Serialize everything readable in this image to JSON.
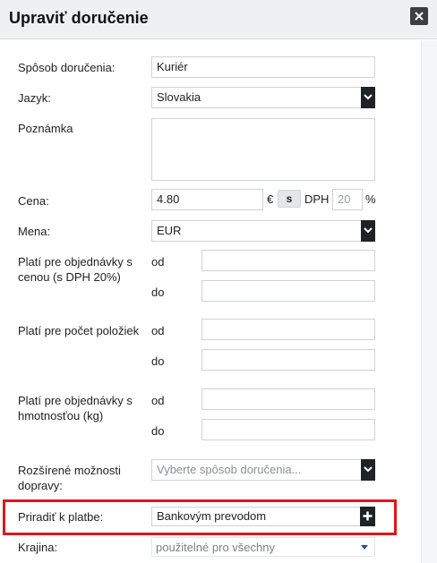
{
  "dialog": {
    "title": "Upraviť doručenie",
    "close_icon": "close-icon"
  },
  "form": {
    "sposob": {
      "label": "Spôsob doručenia:",
      "value": "Kuriér"
    },
    "jazyk": {
      "label": "Jazyk:",
      "value": "Slovakia"
    },
    "poznamka": {
      "label": "Poznámka",
      "value": ""
    },
    "cena": {
      "label": "Cena:",
      "value": "4.80",
      "currency_symbol": "€",
      "s_button": "s",
      "dph_label": "DPH",
      "dph_value": "20",
      "percent": "%"
    },
    "mena": {
      "label": "Mena:",
      "value": "EUR"
    },
    "cenou": {
      "label_line1": "Platí pre objednávky s",
      "label_line2": "cenou (s DPH 20%)",
      "od": "od",
      "do": "do",
      "od_value": "",
      "do_value": ""
    },
    "pocet": {
      "label": "Platí pre počet položiek",
      "od": "od",
      "do": "do",
      "od_value": "",
      "do_value": ""
    },
    "hmotnost": {
      "label_line1": "Platí pre objednávky s",
      "label_line2": "hmotnosťou (kg)",
      "od": "od",
      "do": "do",
      "od_value": "",
      "do_value": ""
    },
    "rozsirene": {
      "label_line1": "Rozšírené možnosti",
      "label_line2": "dopravy:",
      "placeholder": "Vyberte spôsob doručenia..."
    },
    "priradit": {
      "label": "Priradiť k platbe:",
      "value": "Bankovým prevodom"
    },
    "krajina": {
      "label": "Krajina:",
      "value": "použitelné pro všechny"
    }
  },
  "colors": {
    "highlight": "#e0161b",
    "header_bg": "#eef0f2",
    "dark_button": "#1f2226"
  }
}
